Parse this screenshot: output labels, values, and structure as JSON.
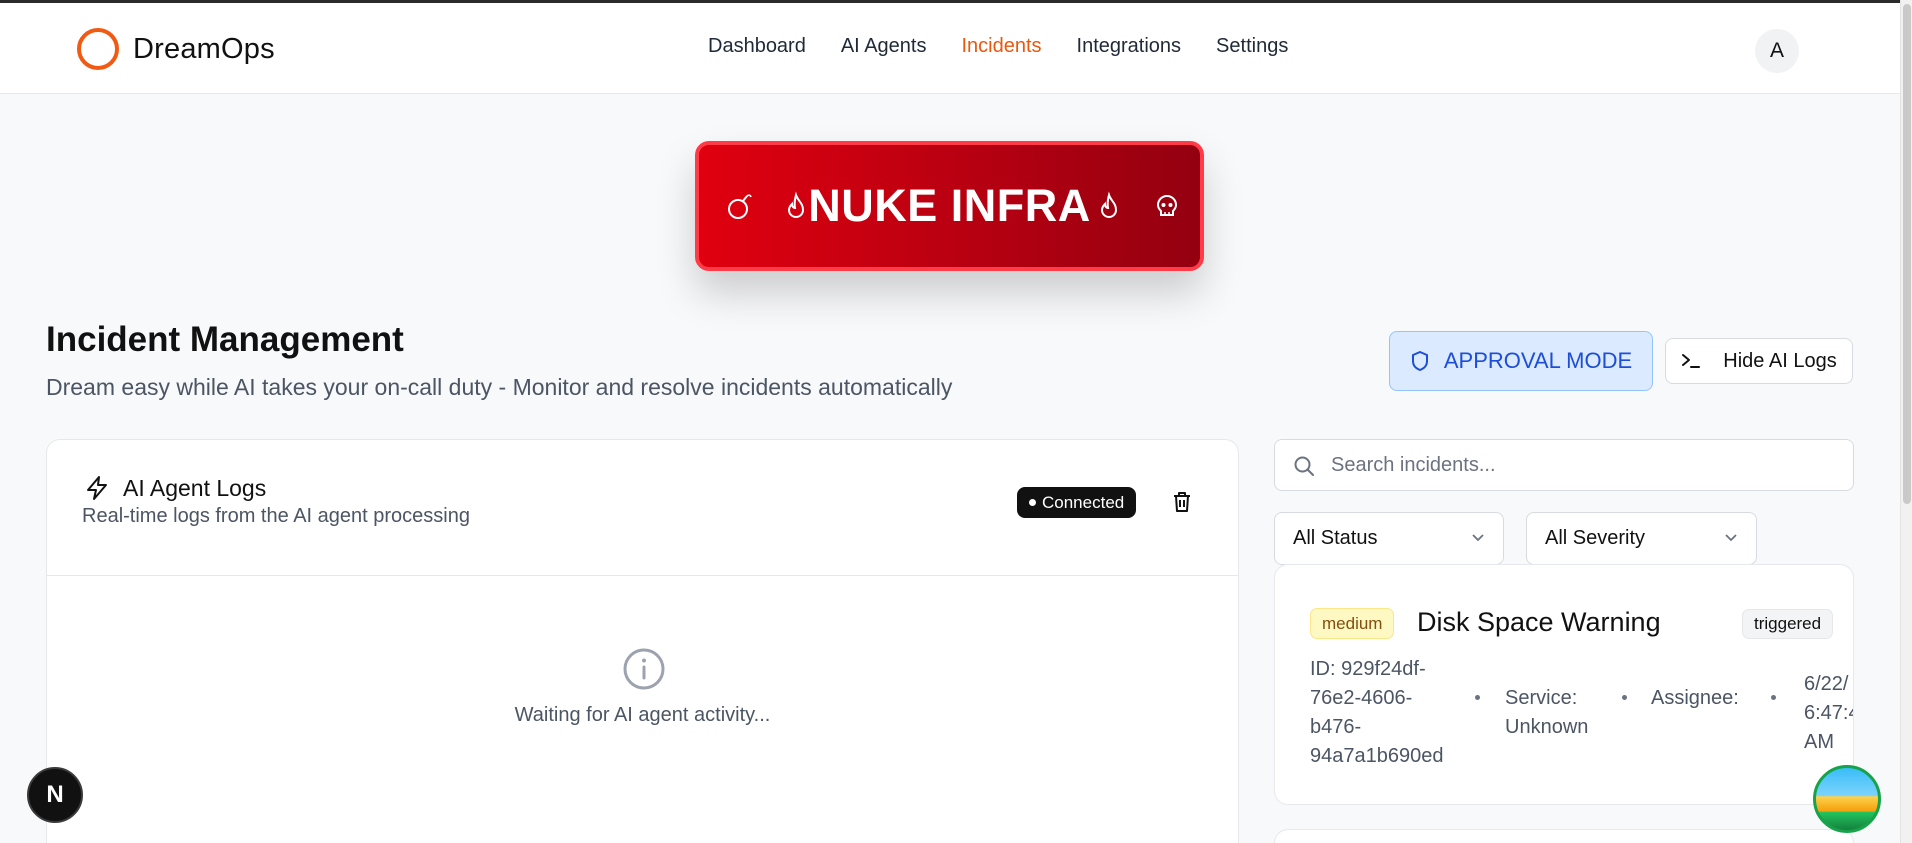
{
  "header": {
    "brand": "DreamOps",
    "nav": [
      {
        "label": "Dashboard",
        "active": false
      },
      {
        "label": "AI Agents",
        "active": false
      },
      {
        "label": "Incidents",
        "active": true
      },
      {
        "label": "Integrations",
        "active": false
      },
      {
        "label": "Settings",
        "active": false
      }
    ],
    "avatar_initial": "A"
  },
  "nuke_button": {
    "label": "NUKE INFRA",
    "icons": [
      "bomb-icon",
      "flame-icon",
      "flame-icon",
      "skull-icon"
    ]
  },
  "page": {
    "title": "Incident Management",
    "subtitle": "Dream easy while AI takes your on-call duty - Monitor and resolve incidents automatically",
    "approval_mode_label": "APPROVAL MODE",
    "hide_logs_label": "Hide AI Logs"
  },
  "logs": {
    "title": "AI Agent Logs",
    "subtitle": "Real-time logs from the AI agent processing",
    "connection_status": "Connected",
    "empty_text": "Waiting for AI agent activity..."
  },
  "filters": {
    "search_placeholder": "Search incidents...",
    "status_selected": "All Status",
    "severity_selected": "All Severity"
  },
  "incidents": [
    {
      "severity": "medium",
      "title": "Disk Space Warning",
      "status": "triggered",
      "id_lines": [
        "ID: 929f24df-",
        "76e2-4606-",
        "b476-",
        "94a7a1b690ed"
      ],
      "service_lines": [
        "Service:",
        "Unknown"
      ],
      "assignee": "Assignee:",
      "time_lines": [
        "6/22/",
        "6:47:4",
        "AM"
      ]
    }
  ],
  "colors": {
    "accent": "#ea580c",
    "nuke_red": "#e0000f",
    "approval_blue": "#1d4ed8",
    "medium_badge_bg": "#fef9c3"
  }
}
